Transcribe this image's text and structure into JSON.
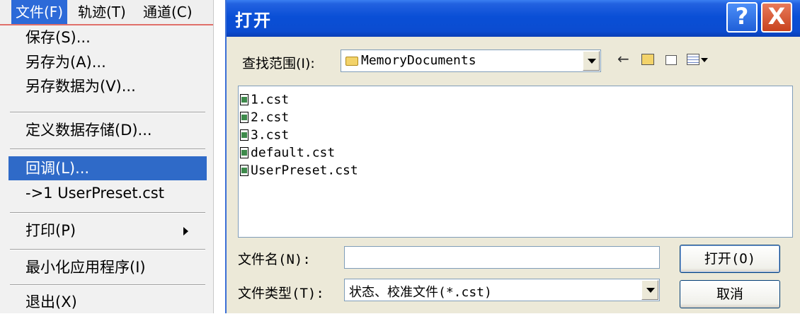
{
  "menubar": {
    "items": [
      "文件(F)",
      "轨迹(T)",
      "通道(C)"
    ]
  },
  "menu": {
    "items": [
      {
        "label": "保存(S)..."
      },
      {
        "label": "另存为(A)..."
      },
      {
        "label": "另存数据为(V)..."
      },
      {
        "label": "定义数据存储(D)..."
      },
      {
        "label": "回调(L)..."
      },
      {
        "label": "->1 UserPreset.cst"
      },
      {
        "label": "打印(P)"
      },
      {
        "label": "最小化应用程序(I)"
      },
      {
        "label": "退出(X)"
      }
    ],
    "highlight_color": "#2f6ac8"
  },
  "dialog": {
    "title": "打开",
    "help_label": "?",
    "close_label": "X",
    "look_in_label": "查找范围(I):",
    "look_in_value": "MemoryDocuments",
    "toolbar_icons": [
      "back-arrow-icon",
      "up-folder-icon",
      "new-folder-icon",
      "view-menu-icon"
    ],
    "files": [
      "1.cst",
      "2.cst",
      "3.cst",
      "default.cst",
      "UserPreset.cst"
    ],
    "filename_label": "文件名(N):",
    "filename_value": "",
    "filetype_label": "文件类型(T):",
    "filetype_value": "状态、校准文件(*.cst)",
    "open_button": "打开(O)",
    "cancel_button": "取消",
    "title_color": "#0a4fd6"
  }
}
